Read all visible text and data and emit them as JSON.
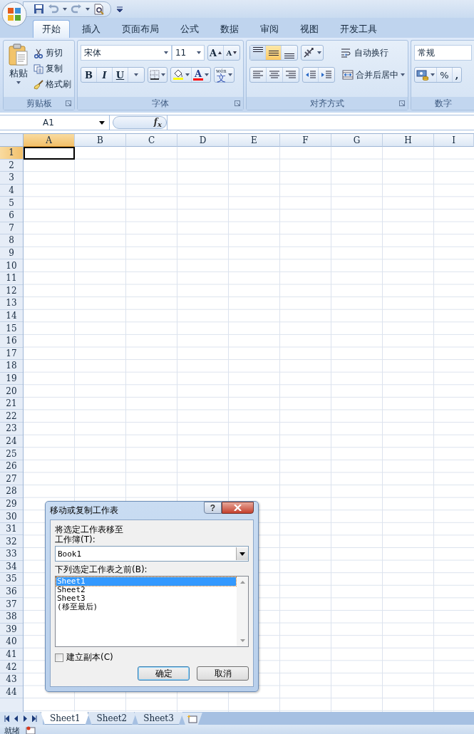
{
  "tabs": [
    {
      "label": "开始",
      "selected": true
    },
    {
      "label": "插入",
      "selected": false
    },
    {
      "label": "页面布局",
      "selected": false
    },
    {
      "label": "公式",
      "selected": false
    },
    {
      "label": "数据",
      "selected": false
    },
    {
      "label": "审阅",
      "selected": false
    },
    {
      "label": "视图",
      "selected": false
    },
    {
      "label": "开发工具",
      "selected": false
    }
  ],
  "ribbon": {
    "clipboard": {
      "paste": "粘贴",
      "cut": "剪切",
      "copy": "复制",
      "format_painter": "格式刷",
      "title": "剪贴板"
    },
    "font": {
      "font_name": "宋体",
      "font_size": "11",
      "grow": "A",
      "shrink": "A",
      "bold": "B",
      "italic": "I",
      "underline": "U",
      "font_color": "A",
      "phonetic_top": "wén",
      "phonetic": "文",
      "title": "字体"
    },
    "alignment": {
      "vertical": [
        {
          "kind": "top",
          "selected": false
        },
        {
          "kind": "middle",
          "selected": true
        },
        {
          "kind": "bottom",
          "selected": false
        }
      ],
      "wrap_text": "自动换行",
      "merge_center": "合并后居中",
      "title": "对齐方式"
    },
    "number": {
      "format": "常规",
      "percent": "%",
      "comma": ",",
      "title": "数字"
    }
  },
  "formula_bar": {
    "name_box": "A1",
    "fx": "f$_{x}$"
  },
  "grid": {
    "columns": [
      {
        "label": "A",
        "selected": true
      },
      {
        "label": "B",
        "selected": false
      },
      {
        "label": "C",
        "selected": false
      },
      {
        "label": "D",
        "selected": false
      },
      {
        "label": "E",
        "selected": false
      },
      {
        "label": "F",
        "selected": false
      },
      {
        "label": "G",
        "selected": false
      },
      {
        "label": "H",
        "selected": false
      },
      {
        "label": "I",
        "selected": false
      }
    ],
    "rows": [
      {
        "label": "1",
        "selected": true
      },
      {
        "label": "2",
        "selected": false
      },
      {
        "label": "3",
        "selected": false
      },
      {
        "label": "4",
        "selected": false
      },
      {
        "label": "5",
        "selected": false
      },
      {
        "label": "6",
        "selected": false
      },
      {
        "label": "7",
        "selected": false
      },
      {
        "label": "8",
        "selected": false
      },
      {
        "label": "9",
        "selected": false
      },
      {
        "label": "10",
        "selected": false
      },
      {
        "label": "11",
        "selected": false
      },
      {
        "label": "12",
        "selected": false
      },
      {
        "label": "13",
        "selected": false
      },
      {
        "label": "14",
        "selected": false
      },
      {
        "label": "15",
        "selected": false
      },
      {
        "label": "16",
        "selected": false
      },
      {
        "label": "17",
        "selected": false
      },
      {
        "label": "18",
        "selected": false
      },
      {
        "label": "19",
        "selected": false
      },
      {
        "label": "20",
        "selected": false
      },
      {
        "label": "21",
        "selected": false
      },
      {
        "label": "22",
        "selected": false
      },
      {
        "label": "23",
        "selected": false
      },
      {
        "label": "24",
        "selected": false
      },
      {
        "label": "25",
        "selected": false
      },
      {
        "label": "26",
        "selected": false
      },
      {
        "label": "27",
        "selected": false
      },
      {
        "label": "28",
        "selected": false
      },
      {
        "label": "29",
        "selected": false
      },
      {
        "label": "30",
        "selected": false
      },
      {
        "label": "31",
        "selected": false
      },
      {
        "label": "32",
        "selected": false
      },
      {
        "label": "33",
        "selected": false
      },
      {
        "label": "34",
        "selected": false
      },
      {
        "label": "35",
        "selected": false
      },
      {
        "label": "36",
        "selected": false
      },
      {
        "label": "37",
        "selected": false
      },
      {
        "label": "38",
        "selected": false
      },
      {
        "label": "39",
        "selected": false
      },
      {
        "label": "40",
        "selected": false
      },
      {
        "label": "41",
        "selected": false
      },
      {
        "label": "42",
        "selected": false
      },
      {
        "label": "43",
        "selected": false
      },
      {
        "label": "44",
        "selected": false
      }
    ]
  },
  "dialog": {
    "title": "移动或复制工作表",
    "help": "?",
    "move_to": "将选定工作表移至",
    "workbook_label": "工作簿(T):",
    "workbook": "Book1",
    "before_label": "下列选定工作表之前(B):",
    "sheets": [
      {
        "label": "Sheet1",
        "selected": true
      },
      {
        "label": "Sheet2",
        "selected": false
      },
      {
        "label": "Sheet3",
        "selected": false
      },
      {
        "label": "(移至最后)",
        "selected": false
      }
    ],
    "create_copy": {
      "label": "建立副本(C)",
      "checked": false
    },
    "ok": "确定",
    "cancel": "取消"
  },
  "sheet_tabs": [
    {
      "label": "Sheet1",
      "selected": true
    },
    {
      "label": "Sheet2",
      "selected": false
    },
    {
      "label": "Sheet3",
      "selected": false
    }
  ],
  "status": "就绪"
}
